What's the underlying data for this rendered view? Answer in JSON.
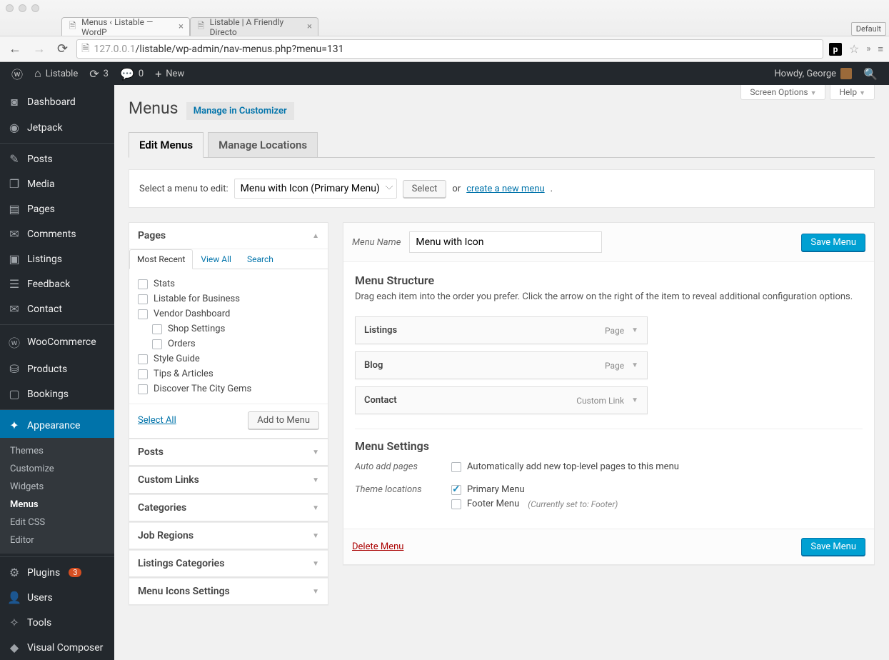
{
  "browser": {
    "tabs": [
      {
        "title": "Menus ‹ Listable — WordP"
      },
      {
        "title": "Listable | A Friendly Directo"
      }
    ],
    "default_label": "Default",
    "url_host": "127.0.0.1",
    "url_path": "/listable/wp-admin/nav-menus.php?menu=131"
  },
  "adminbar": {
    "site": "Listable",
    "updates": "3",
    "comments": "0",
    "new": "New",
    "howdy": "Howdy, George"
  },
  "sidebar": {
    "items": [
      {
        "label": "Dashboard",
        "icon": "◙"
      },
      {
        "label": "Jetpack",
        "icon": "◉"
      },
      {
        "label": "Posts",
        "icon": "✎",
        "sep": true
      },
      {
        "label": "Media",
        "icon": "❐"
      },
      {
        "label": "Pages",
        "icon": "▤"
      },
      {
        "label": "Comments",
        "icon": "✉"
      },
      {
        "label": "Listings",
        "icon": "▣"
      },
      {
        "label": "Feedback",
        "icon": "☰"
      },
      {
        "label": "Contact",
        "icon": "✉"
      },
      {
        "label": "WooCommerce",
        "icon": "ⓦ",
        "sep": true
      },
      {
        "label": "Products",
        "icon": "⛁"
      },
      {
        "label": "Bookings",
        "icon": "▢"
      },
      {
        "label": "Appearance",
        "icon": "✦",
        "sep": true,
        "current": true
      },
      {
        "label": "Plugins",
        "icon": "⚙",
        "badge": "3",
        "sep": true
      },
      {
        "label": "Users",
        "icon": "👤"
      },
      {
        "label": "Tools",
        "icon": "✧"
      },
      {
        "label": "Visual Composer",
        "icon": "◆"
      }
    ],
    "appearance_sub": [
      "Themes",
      "Customize",
      "Widgets",
      "Menus",
      "Edit CSS",
      "Editor"
    ],
    "appearance_current": "Menus"
  },
  "page": {
    "title": "Menus",
    "customizer": "Manage in Customizer",
    "screen_options": "Screen Options",
    "help": "Help",
    "tab_edit": "Edit Menus",
    "tab_locations": "Manage Locations",
    "select_label": "Select a menu to edit:",
    "select_value": "Menu with Icon (Primary Menu)",
    "select_btn": "Select",
    "or": "or",
    "create_link": "create a new menu"
  },
  "left": {
    "pages_title": "Pages",
    "inner_tabs": [
      "Most Recent",
      "View All",
      "Search"
    ],
    "page_items": [
      {
        "label": "Stats"
      },
      {
        "label": "Listable for Business"
      },
      {
        "label": "Vendor Dashboard"
      },
      {
        "label": "Shop Settings",
        "indent": true
      },
      {
        "label": "Orders",
        "indent": true
      },
      {
        "label": "Style Guide"
      },
      {
        "label": "Tips & Articles"
      },
      {
        "label": "Discover The City Gems"
      }
    ],
    "select_all": "Select All",
    "add_to_menu": "Add to Menu",
    "boxes": [
      "Posts",
      "Custom Links",
      "Categories",
      "Job Regions",
      "Listings Categories",
      "Menu Icons Settings"
    ]
  },
  "editor": {
    "menu_name_label": "Menu Name",
    "menu_name": "Menu with Icon",
    "save": "Save Menu",
    "structure_title": "Menu Structure",
    "structure_desc": "Drag each item into the order you prefer. Click the arrow on the right of the item to reveal additional configuration options.",
    "items": [
      {
        "title": "Listings",
        "type": "Page"
      },
      {
        "title": "Blog",
        "type": "Page"
      },
      {
        "title": "Contact",
        "type": "Custom Link"
      }
    ],
    "settings_title": "Menu Settings",
    "auto_add_label": "Auto add pages",
    "auto_add_text": "Automatically add new top-level pages to this menu",
    "locations_label": "Theme locations",
    "loc_primary": "Primary Menu",
    "loc_footer": "Footer Menu",
    "loc_footer_note": "(Currently set to: Footer)",
    "delete": "Delete Menu"
  }
}
